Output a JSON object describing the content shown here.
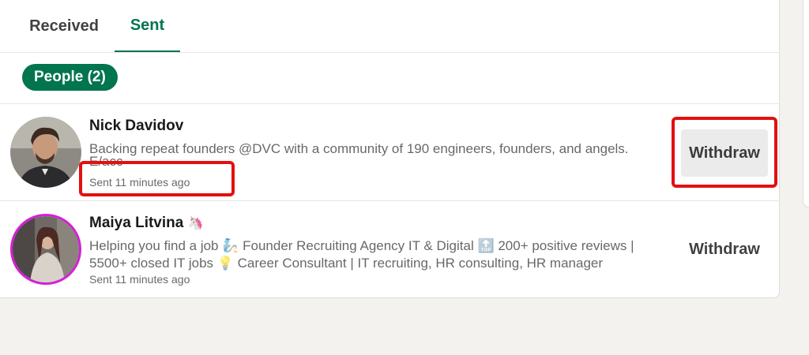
{
  "tabs": [
    {
      "label": "Received"
    },
    {
      "label": "Sent"
    }
  ],
  "active_tab": "Sent",
  "filter": {
    "label": "People (2)"
  },
  "invitations": [
    {
      "name": "Nick Davidov",
      "headline_line1": "Backing repeat founders @DVC with a community of 190 engineers, founders, and angels.",
      "headline_line2": "E/acc",
      "sent": "Sent 11 minutes ago",
      "action": "Withdraw"
    },
    {
      "name": "Maiya Litvina",
      "name_emoji": "🦄",
      "headline_line1": "Helping you find a job 🧞 Founder Recruiting Agency IT & Digital 🔝 200+ positive reviews |",
      "headline_line2": "5500+ closed IT jobs 💡 Career Consultant | IT recruiting, HR consulting, HR manager",
      "sent": "Sent 11 minutes ago",
      "action": "Withdraw"
    }
  ],
  "colors": {
    "accent": "#01754f",
    "highlight": "#e31010",
    "background": "#f4f2ee"
  }
}
